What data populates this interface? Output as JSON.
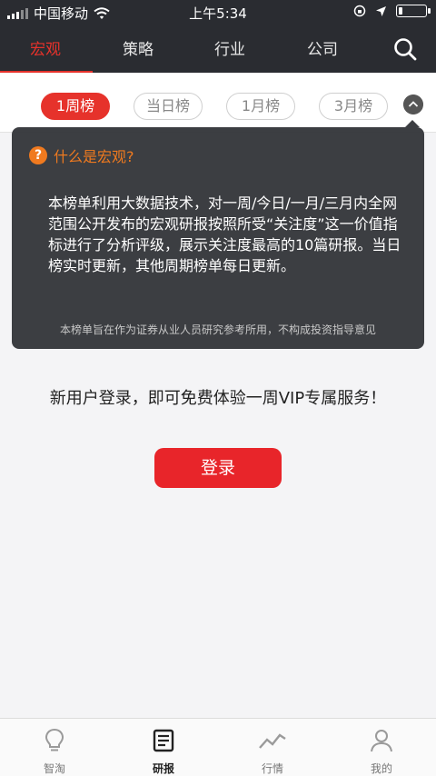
{
  "status_bar": {
    "carrier": "中国移动",
    "time": "上午5:34",
    "battery_level": 0.15
  },
  "nav": {
    "tabs": [
      {
        "label": "宏观",
        "active": true
      },
      {
        "label": "策略",
        "active": false
      },
      {
        "label": "行业",
        "active": false
      },
      {
        "label": "公司",
        "active": false
      }
    ],
    "search_icon": "search-icon"
  },
  "filters": [
    {
      "label": "1周榜",
      "active": true
    },
    {
      "label": "当日榜",
      "active": false
    },
    {
      "label": "1月榜",
      "active": false
    },
    {
      "label": "3月榜",
      "active": false
    }
  ],
  "popover": {
    "title": "什么是宏观?",
    "body": "本榜单利用大数据技术，对一周/今日/一月/三月内全网范围公开发布的宏观研报按照所受“关注度”这一价值指标进行了分析评级，展示关注度最高的10篇研报。当日榜实时更新，其他周期榜单每日更新。",
    "note": "本榜单旨在作为证券从业人员研究参考所用，不构成投资指导意见"
  },
  "main": {
    "promo": "新用户登录，即可免费体验一周VIP专属服务！",
    "login_label": "登录"
  },
  "tab_bar": {
    "items": [
      {
        "label": "智淘",
        "icon": "lightbulb-icon",
        "active": false
      },
      {
        "label": "研报",
        "icon": "report-icon",
        "active": true
      },
      {
        "label": "行情",
        "icon": "trend-icon",
        "active": false
      },
      {
        "label": "我的",
        "icon": "user-icon",
        "active": false
      }
    ]
  },
  "colors": {
    "accent": "#e6322b",
    "nav_bg": "#2a2c31",
    "popover_accent": "#f07a1f"
  }
}
